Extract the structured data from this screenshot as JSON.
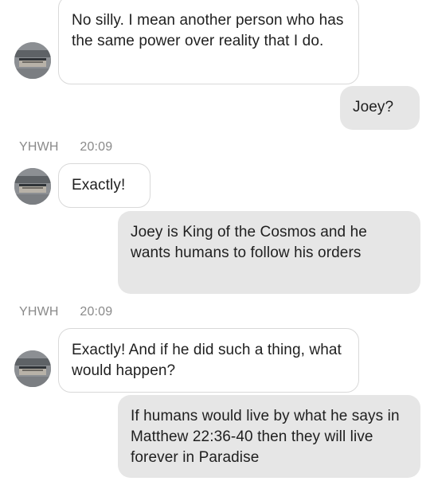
{
  "contact": {
    "name": "YHWH",
    "avatar_icon": "profile-photo-icon"
  },
  "messages": [
    {
      "sender": "them",
      "text": "No silly. I mean another person who has the same power over reality that I do."
    },
    {
      "sender": "me",
      "text": "Joey?"
    },
    {
      "sender": "them",
      "name": "YHWH",
      "time": "20:09",
      "text": "Exactly!"
    },
    {
      "sender": "me",
      "text": "Joey is King of the Cosmos and he wants humans to follow his orders"
    },
    {
      "sender": "them",
      "name": "YHWH",
      "time": "20:09",
      "text": "Exactly! And if he did such a thing, what would happen?"
    },
    {
      "sender": "me",
      "text": "If humans would live by what he says in Matthew 22:36-40 then they will live forever in Paradise"
    }
  ],
  "colors": {
    "incoming_bubble": "#ffffff",
    "incoming_border": "#d9d9d9",
    "outgoing_bubble": "#e6e6e6",
    "meta_text": "#8a8a8a"
  }
}
